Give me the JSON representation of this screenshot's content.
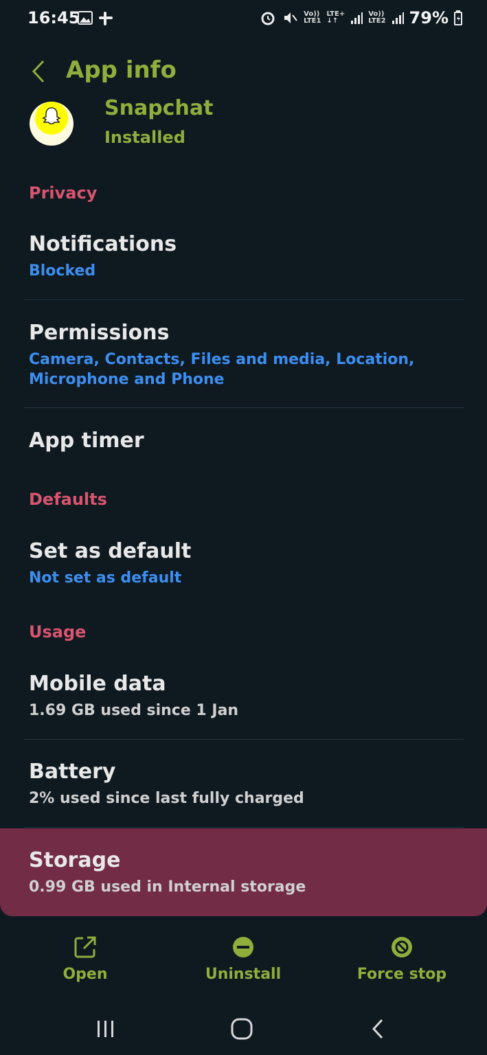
{
  "status_bar": {
    "time": "16:45",
    "battery": "79%",
    "signal_text_1_top": "Vo))",
    "signal_text_1_bottom": "LTE1",
    "lte_top": "LTE+",
    "signal_text_2_top": "Vo))",
    "signal_text_2_bottom": "LTE2"
  },
  "header": {
    "title": "App info"
  },
  "app": {
    "name": "Snapchat",
    "status": "Installed"
  },
  "sections": {
    "privacy": "Privacy",
    "defaults": "Defaults",
    "usage": "Usage"
  },
  "items": {
    "notifications": {
      "title": "Notifications",
      "sub": "Blocked"
    },
    "permissions": {
      "title": "Permissions",
      "sub": "Camera, Contacts, Files and media, Location, Microphone and Phone"
    },
    "app_timer": {
      "title": "App timer"
    },
    "set_default": {
      "title": "Set as default",
      "sub": "Not set as default"
    },
    "mobile_data": {
      "title": "Mobile data",
      "sub": "1.69 GB used since 1 Jan"
    },
    "battery": {
      "title": "Battery",
      "sub": "2% used since last fully charged"
    },
    "storage": {
      "title": "Storage",
      "sub": "0.99 GB used in Internal storage"
    }
  },
  "actions": {
    "open": "Open",
    "uninstall": "Uninstall",
    "force_stop": "Force stop"
  },
  "colors": {
    "background": "#0e1920",
    "accent_green": "#8fae3c",
    "section_pink": "#d9546f",
    "link_blue": "#3d8ef0",
    "highlight": "#722c46"
  }
}
